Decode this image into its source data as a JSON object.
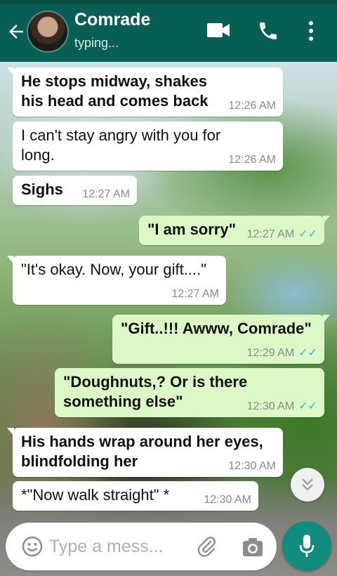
{
  "header": {
    "contact_name": "Comrade",
    "status": "typing...",
    "icons": [
      "back-arrow-icon",
      "video-call-icon",
      "voice-call-icon",
      "more-options-icon"
    ]
  },
  "messages": [
    {
      "direction": "in",
      "bold": true,
      "text": "He stops midway, shakes his head and comes back",
      "time": "12:26 AM"
    },
    {
      "direction": "in",
      "bold": false,
      "text": "I can't stay angry with you for long.",
      "time": "12:26 AM"
    },
    {
      "direction": "in",
      "bold": true,
      "text": "Sighs",
      "time": "12:27 AM"
    },
    {
      "direction": "out",
      "bold": true,
      "text": "\"I am sorry\"",
      "time": "12:27 AM",
      "read": true
    },
    {
      "direction": "in",
      "bold": false,
      "text": "\"It's okay. Now, your gift....\"",
      "time": "12:27 AM"
    },
    {
      "direction": "out",
      "bold": true,
      "text": "\"Gift..!!! Awww, Comrade\"",
      "time": "12:29 AM",
      "read": true
    },
    {
      "direction": "out",
      "bold": true,
      "text": "\"Doughnuts,? Or is there something else\"",
      "time": "12:30 AM",
      "read": true
    },
    {
      "direction": "in",
      "bold": true,
      "text": "His hands wrap around her eyes, blindfolding her",
      "time": "12:30 AM"
    },
    {
      "direction": "in",
      "bold": false,
      "text": "*\"Now walk straight\" *",
      "time": "12:30 AM"
    }
  ],
  "tick_symbol": "✓✓",
  "composer": {
    "placeholder": "Type a mess...",
    "icons": [
      "emoji-icon",
      "attach-icon",
      "camera-icon",
      "mic-icon"
    ]
  },
  "colors": {
    "header": "#075e54",
    "incoming_bubble": "#ffffff",
    "outgoing_bubble": "#dcf8c6",
    "read_tick": "#34b7f1",
    "mic_button": "#128c7e"
  }
}
